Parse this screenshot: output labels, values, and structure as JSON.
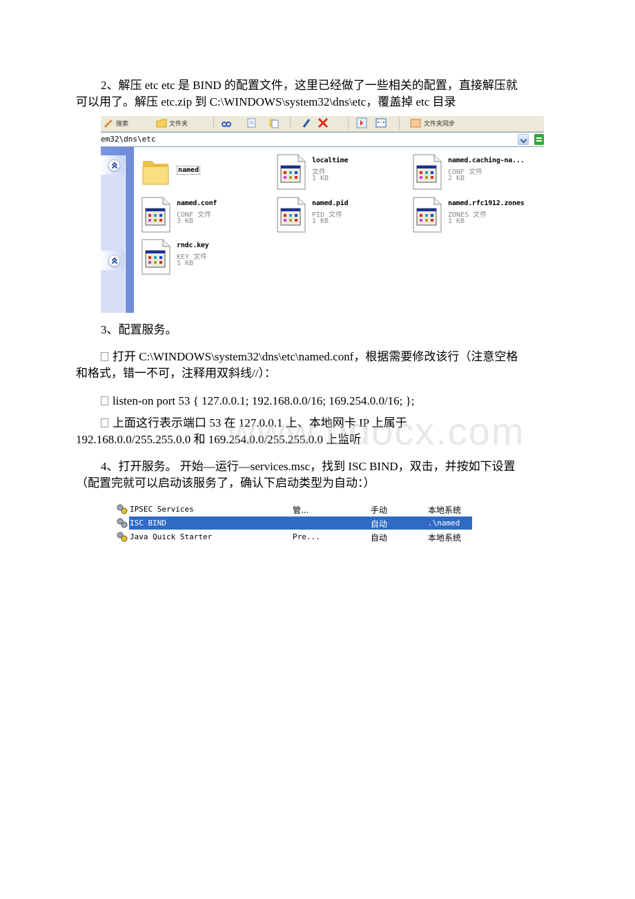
{
  "document": {
    "step2": {
      "line1": "2、解压 etc etc 是 BIND 的配置文件，这里已经做了一些相关的配置，直接解压就",
      "line2": "可以用了。解压 etc.zip 到 C:\\WINDOWS\\system32\\dns\\etc，覆盖掉 etc 目录"
    },
    "step3": {
      "heading": "3、配置服务。",
      "open_line1": "打开 C:\\WINDOWS\\system32\\dns\\etc\\named.conf，根据需要修改该行（注意空格",
      "open_line2": "和格式，错一不可，注释用双斜线//）：",
      "listen_line": "listen-on port 53 { 127.0.0.1; 192.168.0.0/16; 169.254.0.0/16; };",
      "explain_line1": "上面这行表示端口 53 在 127.0.0.1 上、本地网卡 IP 上属于",
      "explain_line2": "192.168.0.0/255.255.0.0 和 169.254.0.0/255.255.0.0 上监听"
    },
    "step4": {
      "line1": "4、打开服务。 开始—运行—services.msc，找到 ISC BIND，双击，并按如下设置",
      "line2": "（配置完就可以启动该服务了，确认下启动类型为自动：）"
    },
    "watermark": "www.bdocx.com"
  },
  "explorer": {
    "toolbar": {
      "search_label": "搜索",
      "folders_label": "文件夹",
      "sync_label": "文件夹同步"
    },
    "address": "em32\\dns\\etc",
    "files": [
      {
        "name": "named",
        "type": "folder",
        "type_label": "",
        "size": ""
      },
      {
        "name": "localtime",
        "type": "file",
        "type_label": "文件",
        "size": "1 KB"
      },
      {
        "name": "named.caching-na...",
        "type": "file",
        "type_label": "CONF 文件",
        "size": "2 KB"
      },
      {
        "name": "named.conf",
        "type": "file",
        "type_label": "CONF 文件",
        "size": "3 KB"
      },
      {
        "name": "named.pid",
        "type": "file",
        "type_label": "PID 文件",
        "size": "1 KB"
      },
      {
        "name": "named.rfc1912.zones",
        "type": "file",
        "type_label": "ZONES 文件",
        "size": "1 KB"
      },
      {
        "name": "rndc.key",
        "type": "file",
        "type_label": "KEY 文件",
        "size": "1 KB"
      }
    ]
  },
  "services": {
    "rows": [
      {
        "name": "IPSEC Services",
        "description": "管...",
        "startup": "手动",
        "logon": "本地系统",
        "selected": false
      },
      {
        "name": "ISC BIND",
        "description": "",
        "startup": "自动",
        "logon": ".\\named",
        "selected": true
      },
      {
        "name": "Java Quick Starter",
        "description": "Pre...",
        "startup": "自动",
        "logon": "本地系统",
        "selected": false
      }
    ],
    "highlight_color": "#316ac5"
  }
}
